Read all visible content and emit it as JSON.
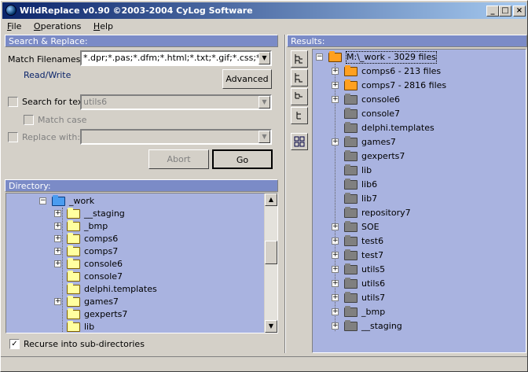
{
  "window": {
    "title": "WildReplace v0.90 ©2003-2004 CyLog Software"
  },
  "menu": [
    "File",
    "Operations",
    "Help"
  ],
  "search": {
    "header": "Search & Replace:",
    "match_label": "Match Filenames:",
    "match_value": "*.dpr;*.pas;*.dfm;*.html;*.txt;*.gif;*.css;*.ico;*.bm",
    "mode": "Read/Write",
    "advanced": "Advanced",
    "search_label": "Search for text:",
    "search_value": "utils6",
    "search_checked": false,
    "match_case": "Match case",
    "replace_label": "Replace with:",
    "replace_value": "",
    "abort": "Abort",
    "go": "Go"
  },
  "directory": {
    "header": "Directory:",
    "items": [
      {
        "label": "_work",
        "expander": "−",
        "color": "blue",
        "depth": 0
      },
      {
        "label": "__staging",
        "expander": "+",
        "color": "yellow",
        "depth": 1
      },
      {
        "label": "_bmp",
        "expander": "+",
        "color": "yellow",
        "depth": 1
      },
      {
        "label": "comps6",
        "expander": "+",
        "color": "yellow",
        "depth": 1
      },
      {
        "label": "comps7",
        "expander": "+",
        "color": "yellow",
        "depth": 1
      },
      {
        "label": "console6",
        "expander": "+",
        "color": "yellow",
        "depth": 1
      },
      {
        "label": "console7",
        "expander": "",
        "color": "yellow",
        "depth": 1
      },
      {
        "label": "delphi.templates",
        "expander": "",
        "color": "yellow",
        "depth": 1
      },
      {
        "label": "games7",
        "expander": "+",
        "color": "yellow",
        "depth": 1
      },
      {
        "label": "gexperts7",
        "expander": "",
        "color": "yellow",
        "depth": 1
      },
      {
        "label": "lib",
        "expander": "",
        "color": "yellow",
        "depth": 1
      }
    ],
    "recurse_label": "Recurse into sub-directories",
    "recurse_checked": true
  },
  "results": {
    "header": "Results:",
    "root": "M:\\_work - 3029 files",
    "items": [
      {
        "label": "comps6 - 213 files",
        "expander": "+",
        "color": "orange"
      },
      {
        "label": "comps7 - 2816 files",
        "expander": "+",
        "color": "orange"
      },
      {
        "label": "console6",
        "expander": "+",
        "color": "gray"
      },
      {
        "label": "console7",
        "expander": "",
        "color": "gray"
      },
      {
        "label": "delphi.templates",
        "expander": "",
        "color": "gray"
      },
      {
        "label": "games7",
        "expander": "+",
        "color": "gray"
      },
      {
        "label": "gexperts7",
        "expander": "",
        "color": "gray"
      },
      {
        "label": "lib",
        "expander": "",
        "color": "gray"
      },
      {
        "label": "lib6",
        "expander": "",
        "color": "gray"
      },
      {
        "label": "lib7",
        "expander": "",
        "color": "gray"
      },
      {
        "label": "repository7",
        "expander": "",
        "color": "gray"
      },
      {
        "label": "SOE",
        "expander": "+",
        "color": "gray"
      },
      {
        "label": "test6",
        "expander": "+",
        "color": "gray"
      },
      {
        "label": "test7",
        "expander": "+",
        "color": "gray"
      },
      {
        "label": "utils5",
        "expander": "+",
        "color": "gray"
      },
      {
        "label": "utils6",
        "expander": "+",
        "color": "gray"
      },
      {
        "label": "utils7",
        "expander": "+",
        "color": "gray"
      },
      {
        "label": "_bmp",
        "expander": "+",
        "color": "gray"
      },
      {
        "label": "__staging",
        "expander": "+",
        "color": "gray"
      }
    ],
    "tools": [
      "expand-all-icon",
      "collapse-all-icon",
      "expand-level-icon",
      "collapse-level-icon",
      "grid-view-icon"
    ]
  },
  "colors": {
    "panel_header": "#7b8bc7",
    "tree_bg": "#a9b3e0",
    "title_start": "#0a246a",
    "title_end": "#a6caf0"
  }
}
